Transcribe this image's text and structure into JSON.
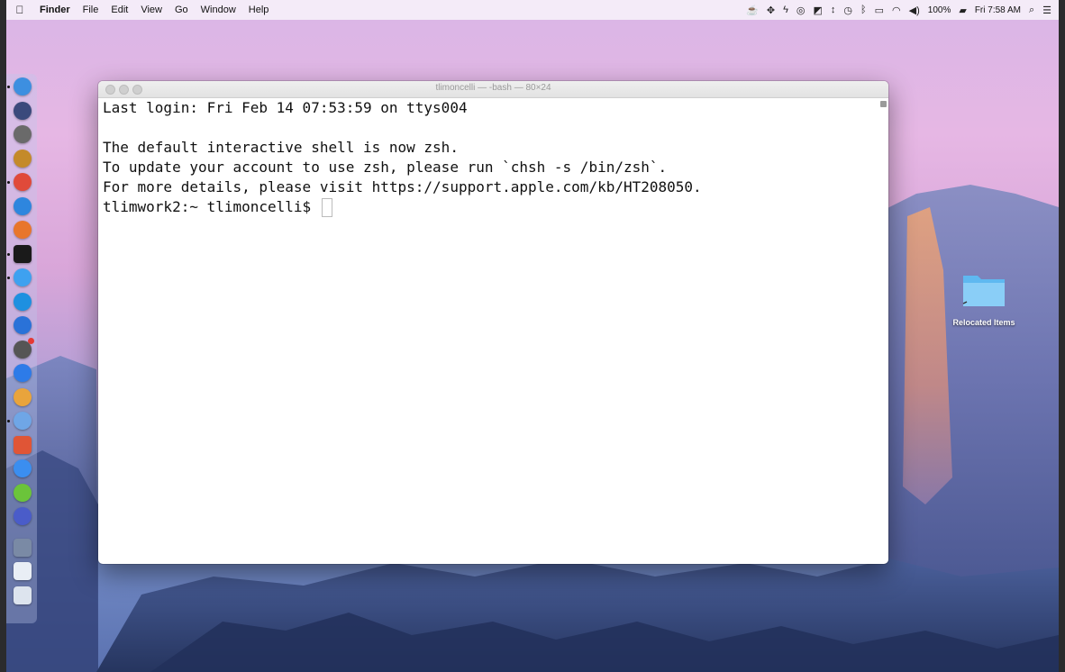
{
  "menubar": {
    "app_name": "Finder",
    "items": [
      "File",
      "Edit",
      "View",
      "Go",
      "Window",
      "Help"
    ],
    "battery": "100%",
    "clock": "Fri 7:58 AM"
  },
  "dock": {
    "items": [
      {
        "name": "finder",
        "color": "#3d8fe0"
      },
      {
        "name": "launchpad",
        "color": "#3b4a7c"
      },
      {
        "name": "rocket",
        "color": "#6a6a6a"
      },
      {
        "name": "podcasts",
        "color": "#c48a2a"
      },
      {
        "name": "chrome",
        "color": "#e04a3a"
      },
      {
        "name": "safari",
        "color": "#2e86de"
      },
      {
        "name": "firefox",
        "color": "#e8762b"
      },
      {
        "name": "terminal",
        "color": "#1a1a1a"
      },
      {
        "name": "messages",
        "color": "#3ea1f0"
      },
      {
        "name": "skype",
        "color": "#1e90e0"
      },
      {
        "name": "signal",
        "color": "#2a72d8"
      },
      {
        "name": "system-preferences",
        "color": "#555555"
      },
      {
        "name": "app-store",
        "color": "#2d7be8"
      },
      {
        "name": "photos",
        "color": "#e9a43c"
      },
      {
        "name": "finder-window",
        "color": "#6fa6e6"
      },
      {
        "name": "zotero",
        "color": "#e05536"
      },
      {
        "name": "itunes",
        "color": "#3b8ef0"
      },
      {
        "name": "lime",
        "color": "#6bc43a"
      },
      {
        "name": "discord",
        "color": "#4a5cc9"
      },
      {
        "name": "stacks",
        "color": "#7a8aa5"
      },
      {
        "name": "document",
        "color": "#e9eef5"
      },
      {
        "name": "trash",
        "color": "#dde4ee"
      }
    ]
  },
  "terminal": {
    "title": "tlimoncelli — -bash — 80×24",
    "lines": [
      "Last login: Fri Feb 14 07:53:59 on ttys004",
      "",
      "The default interactive shell is now zsh.",
      "To update your account to use zsh, please run `chsh -s /bin/zsh`.",
      "For more details, please visit https://support.apple.com/kb/HT208050."
    ],
    "prompt": "tlimwork2:~ tlimoncelli$ "
  },
  "desktop": {
    "folder_label": "Relocated Items",
    "folder_color": "#5fb8f0"
  }
}
